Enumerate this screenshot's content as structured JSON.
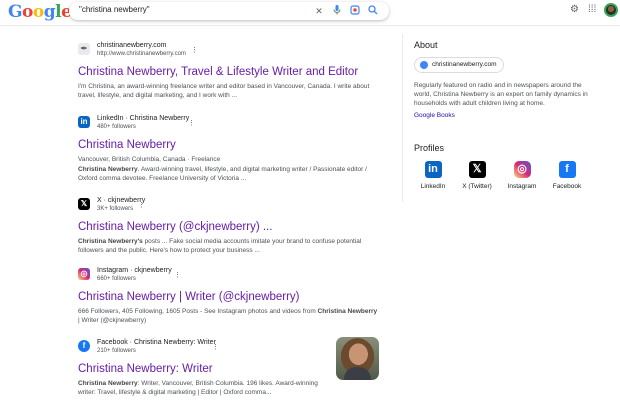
{
  "header": {
    "logo": "Google",
    "query": "\"christina newberry\"",
    "clear_icon": "close-icon",
    "voice_icon": "microphone-icon",
    "lens_icon": "lens-icon",
    "search_icon": "search-icon",
    "settings_icon": "gear-icon",
    "apps_icon": "apps-grid-icon"
  },
  "results": [
    {
      "favicon": "pen-icon",
      "site": "christinanewberry.com",
      "sub": "http://www.christinanewberry.com",
      "title": "Christina Newberry, Travel & Lifestyle Writer and Editor",
      "snippet": [
        {
          "t": "I'm Christina, an award-winning freelance writer and editor based in Vancouver, Canada. I write about travel, lifestyle, and digital marketing, and I work with ..."
        }
      ]
    },
    {
      "favicon": "linkedin-icon",
      "site": "LinkedIn · Christina Newberry",
      "sub": "480+ followers",
      "title": "Christina Newberry",
      "meta": "Vancouver, British Columbia, Canada · Freelance",
      "snippet": [
        {
          "b": "Christina Newberry"
        },
        {
          "t": ". Award-winning travel, lifestyle, and digital marketing writer / Passionate editor / Oxford comma devotee. Freelance University of Victoria ..."
        }
      ]
    },
    {
      "favicon": "x-icon",
      "site": "X · ckjnewberry",
      "sub": "3K+ followers",
      "title": "Christina Newberry (@ckjnewberry) ...",
      "snippet": [
        {
          "b": "Christina Newberry's"
        },
        {
          "t": " posts ... Fake social media accounts imitate your brand to confuse potential followers and the public. Here's how to protect your business ..."
        }
      ]
    },
    {
      "favicon": "instagram-icon",
      "site": "Instagram · ckjnewberry",
      "sub": "660+ followers",
      "title": "Christina Newberry | Writer (@ckjnewberry)",
      "snippet": [
        {
          "t": "666 Followers, 405 Following, 1605 Posts - See Instagram photos and videos from "
        },
        {
          "b": "Christina Newberry"
        },
        {
          "t": " | Writer (@ckjnewberry)"
        }
      ]
    },
    {
      "favicon": "facebook-icon",
      "site": "Facebook · Christina Newberry: Writer",
      "sub": "210+ followers",
      "title": "Christina Newberry: Writer",
      "snippet": [
        {
          "b": "Christina Newberry"
        },
        {
          "t": ": Writer, Vancouver, British Columbia. 196 likes. Award-winning writer: Travel, lifestyle & digital marketing | Editor | Oxford comma..."
        }
      ]
    }
  ],
  "about": {
    "heading": "About",
    "chip": "christinanewberry.com",
    "text": "Regularly featured on radio and in newspapers around the world, Christina Newberry is an expert on family dynamics in households with adult children living at home.",
    "books": "Google Books"
  },
  "profiles": {
    "heading": "Profiles",
    "items": [
      {
        "label": "LinkedIn",
        "icon": "linkedin-icon",
        "color": "#0a66c2"
      },
      {
        "label": "X (Twitter)",
        "icon": "x-icon",
        "color": "#000000"
      },
      {
        "label": "Instagram",
        "icon": "instagram-icon",
        "color": "#d62976"
      },
      {
        "label": "Facebook",
        "icon": "facebook-icon",
        "color": "#1877f2"
      }
    ]
  },
  "colors": {
    "visited_link": "#681da8",
    "link": "#1a0dab",
    "snippet": "#4d5156"
  }
}
